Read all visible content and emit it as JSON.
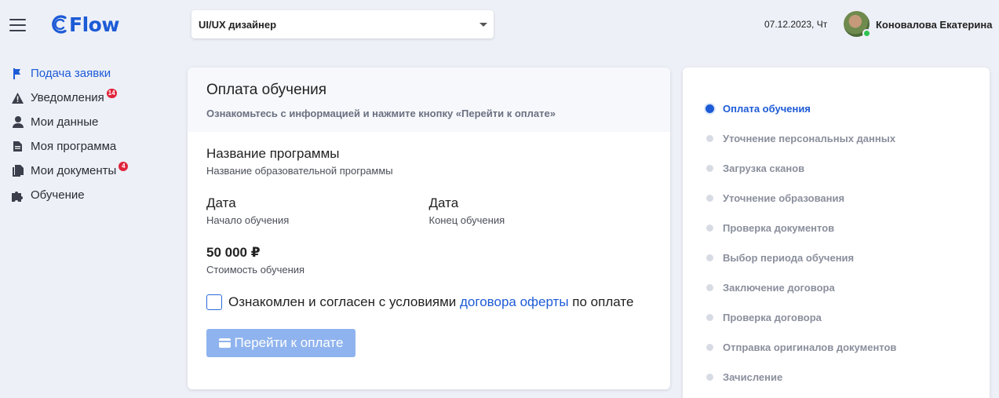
{
  "header": {
    "logo_text": "Flow",
    "program_select": {
      "value": "UI/UX дизайнер"
    },
    "date": "07.12.2023, Чт",
    "user_name": "Коновалова Екатерина"
  },
  "sidebar": {
    "items": [
      {
        "label": "Подача заявки",
        "icon": "flag-icon",
        "active": true
      },
      {
        "label": "Уведомления",
        "icon": "warning-icon",
        "badge": "14"
      },
      {
        "label": "Мои данные",
        "icon": "user-icon"
      },
      {
        "label": "Моя программа",
        "icon": "document-icon"
      },
      {
        "label": "Мои документы",
        "icon": "documents-icon",
        "badge": "4"
      },
      {
        "label": "Обучение",
        "icon": "puzzle-icon"
      }
    ]
  },
  "card": {
    "title": "Оплата обучения",
    "subtitle": "Ознакомьтесь с информацией и нажмите кнопку «Перейти к оплате»",
    "program": {
      "title": "Название программы",
      "sub": "Название образовательной программы"
    },
    "start": {
      "title": "Дата",
      "sub": "Начало обучения"
    },
    "end": {
      "title": "Дата",
      "sub": "Конец обучения"
    },
    "price": {
      "value": "50 000 ₽",
      "sub": "Стоимость обучения"
    },
    "agree": {
      "before": "Ознакомлен и согласен с условиями ",
      "link": "договора оферты",
      "after": " по оплате",
      "checked": false
    },
    "pay_button": "Перейти к оплате"
  },
  "steps": [
    {
      "label": "Оплата обучения",
      "active": true
    },
    {
      "label": "Уточнение персональных данных"
    },
    {
      "label": "Загрузка сканов"
    },
    {
      "label": "Уточнение образования"
    },
    {
      "label": "Проверка документов"
    },
    {
      "label": "Выбор периода обучения"
    },
    {
      "label": "Заключение договора"
    },
    {
      "label": "Проверка договора"
    },
    {
      "label": "Отправка оригиналов документов"
    },
    {
      "label": "Зачисление"
    }
  ],
  "colors": {
    "accent": "#1d5bd6",
    "background": "#edf0f7",
    "badge": "#e0253b",
    "button_disabled": "#8fb3ee"
  }
}
